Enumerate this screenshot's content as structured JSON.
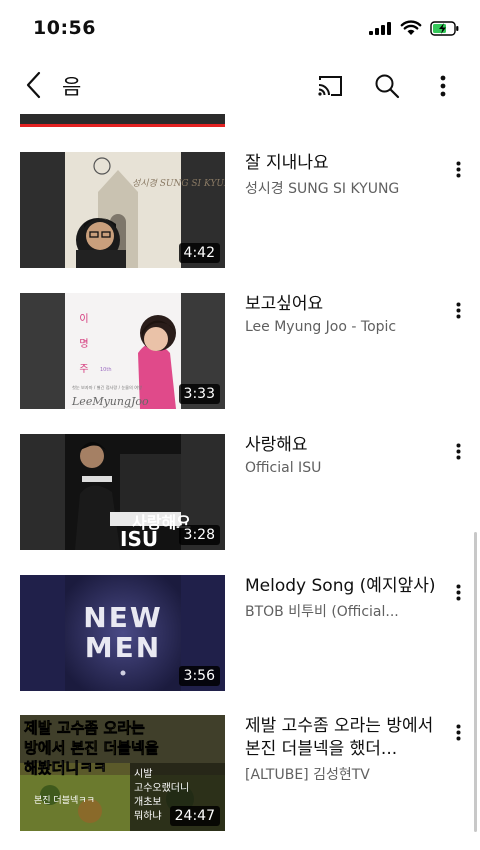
{
  "status": {
    "time": "10:56"
  },
  "header": {
    "title": "음"
  },
  "videos": [
    {
      "title": "잘 지내나요",
      "channel": "성시경 SUNG SI KYUNG",
      "duration": "4:42"
    },
    {
      "title": "보고싶어요",
      "channel": "Lee Myung Joo  - Topic",
      "duration": "3:33"
    },
    {
      "title": "사랑해요",
      "channel": "Official ISU",
      "duration": "3:28"
    },
    {
      "title": "Melody Song (예지앞사)",
      "channel": "BTOB 비투비 (Official...",
      "duration": "3:56"
    },
    {
      "title": "제발 고수좀 오라는 방에서 본진 더블넥을 했더...",
      "channel": "[ALTUBE] 김성현TV",
      "duration": "24:47"
    }
  ],
  "thumbnails": {
    "t1": {
      "album": "성시경 SUNG SI KYUNG"
    },
    "t2": {
      "name_vertical": "이 명 주",
      "edition": "10th",
      "credits": "첫눈 보자마 / 별긴 접사랑 / 눈물의 여왕",
      "signature": "LeeMyungJoo"
    },
    "t3": {
      "text_kr": "사랑해요",
      "text_en": "ISU"
    },
    "t4": {
      "line1": "NEW",
      "line2": "MEN"
    },
    "t5": {
      "headline1": "제발 고수좀 오라는",
      "headline2": "방에서 본진 더블넥을",
      "headline3": "해봤더니ㅋㅋ",
      "chat": [
        "시발",
        "고수오랬더니",
        "개초보",
        "뭐하냐"
      ],
      "caption": "본진 더블넥ㅋㅋ"
    }
  },
  "colors": {
    "accent_red": "#e32222",
    "text_primary": "#0f0f0f",
    "text_secondary": "#606060",
    "battery_green": "#34c759"
  },
  "icons": [
    "chevron-left-icon",
    "cast-icon",
    "search-icon",
    "more-vert-icon"
  ]
}
